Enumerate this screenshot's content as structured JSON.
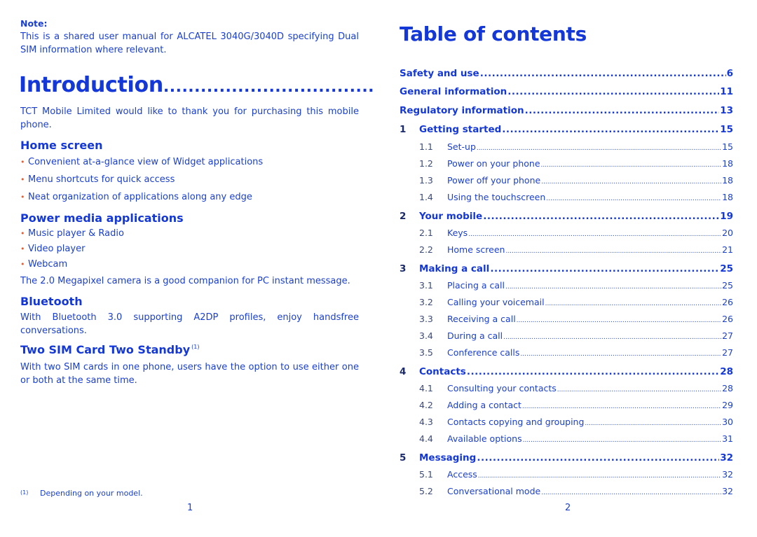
{
  "left_page": {
    "note_label": "Note:",
    "note_text": "This is a shared user manual for ALCATEL 3040G/3040D specifying Dual SIM information where relevant.",
    "intro_title": "Introduction",
    "intro_dots": "..................................",
    "intro_text": "TCT Mobile Limited would like to thank you for purchasing this mobile phone.",
    "sections": [
      {
        "heading": "Home screen",
        "bullets": [
          "Convenient at-a-glance view of Widget applications",
          "Menu shortcuts for quick access",
          "Neat organization of applications along any edge"
        ]
      },
      {
        "heading": "Power media applications",
        "bullets": [
          "Music player & Radio",
          "Video player",
          "Webcam"
        ],
        "text": "The 2.0 Megapixel camera is a good companion for PC instant message."
      },
      {
        "heading": "Bluetooth",
        "text": "With Bluetooth 3.0 supporting A2DP profiles, enjoy handsfree conversations."
      },
      {
        "heading": "Two SIM Card Two Standby",
        "footnote_ref": "(1)",
        "text": "With two SIM cards in one phone, users have the option to use either one or both at the same time."
      }
    ],
    "bullet_glyph": "•",
    "footnote": {
      "mark": "(1)",
      "text": "Depending on your model."
    },
    "page_number": "1"
  },
  "right_page": {
    "title": "Table of contents",
    "entries": [
      {
        "level": "top",
        "num": "",
        "label": "Safety and use",
        "page": "6"
      },
      {
        "level": "top",
        "num": "",
        "label": "General information",
        "page": "11"
      },
      {
        "level": "top",
        "num": "",
        "label": "Regulatory information",
        "page": "13"
      },
      {
        "level": "chap",
        "num": "1",
        "label": "Getting started",
        "page": "15"
      },
      {
        "level": "sub",
        "num": "1.1",
        "label": "Set-up",
        "page": "15"
      },
      {
        "level": "sub",
        "num": "1.2",
        "label": "Power on your phone",
        "page": "18"
      },
      {
        "level": "sub",
        "num": "1.3",
        "label": "Power off your phone",
        "page": "18"
      },
      {
        "level": "sub",
        "num": "1.4",
        "label": "Using the touchscreen",
        "page": "18"
      },
      {
        "level": "chap",
        "num": "2",
        "label": "Your mobile",
        "page": "19"
      },
      {
        "level": "sub",
        "num": "2.1",
        "label": "Keys",
        "page": "20"
      },
      {
        "level": "sub",
        "num": "2.2",
        "label": "Home screen",
        "page": "21"
      },
      {
        "level": "chap",
        "num": "3",
        "label": "Making a call",
        "page": "25"
      },
      {
        "level": "sub",
        "num": "3.1",
        "label": "Placing a call",
        "page": "25"
      },
      {
        "level": "sub",
        "num": "3.2",
        "label": "Calling your voicemail",
        "page": "26"
      },
      {
        "level": "sub",
        "num": "3.3",
        "label": "Receiving a call",
        "page": "26"
      },
      {
        "level": "sub",
        "num": "3.4",
        "label": "During a call",
        "page": "27"
      },
      {
        "level": "sub",
        "num": "3.5",
        "label": "Conference calls",
        "page": "27"
      },
      {
        "level": "chap",
        "num": "4",
        "label": "Contacts",
        "page": "28"
      },
      {
        "level": "sub",
        "num": "4.1",
        "label": "Consulting your contacts",
        "page": "28"
      },
      {
        "level": "sub",
        "num": "4.2",
        "label": "Adding a contact",
        "page": "29"
      },
      {
        "level": "sub",
        "num": "4.3",
        "label": "Contacts copying and grouping",
        "page": "30"
      },
      {
        "level": "sub",
        "num": "4.4",
        "label": "Available options",
        "page": "31"
      },
      {
        "level": "chap",
        "num": "5",
        "label": "Messaging",
        "page": "32"
      },
      {
        "level": "sub",
        "num": "5.1",
        "label": "Access",
        "page": "32"
      },
      {
        "level": "sub",
        "num": "5.2",
        "label": "Conversational mode",
        "page": "32"
      }
    ],
    "page_number": "2"
  },
  "colors": {
    "heading_blue": "#1438d8",
    "text_blue": "#1a3fd0",
    "bullet_orange": "#f05a28",
    "chapter_number": "#1a2a6a",
    "sub_number": "#3a4a7a"
  }
}
